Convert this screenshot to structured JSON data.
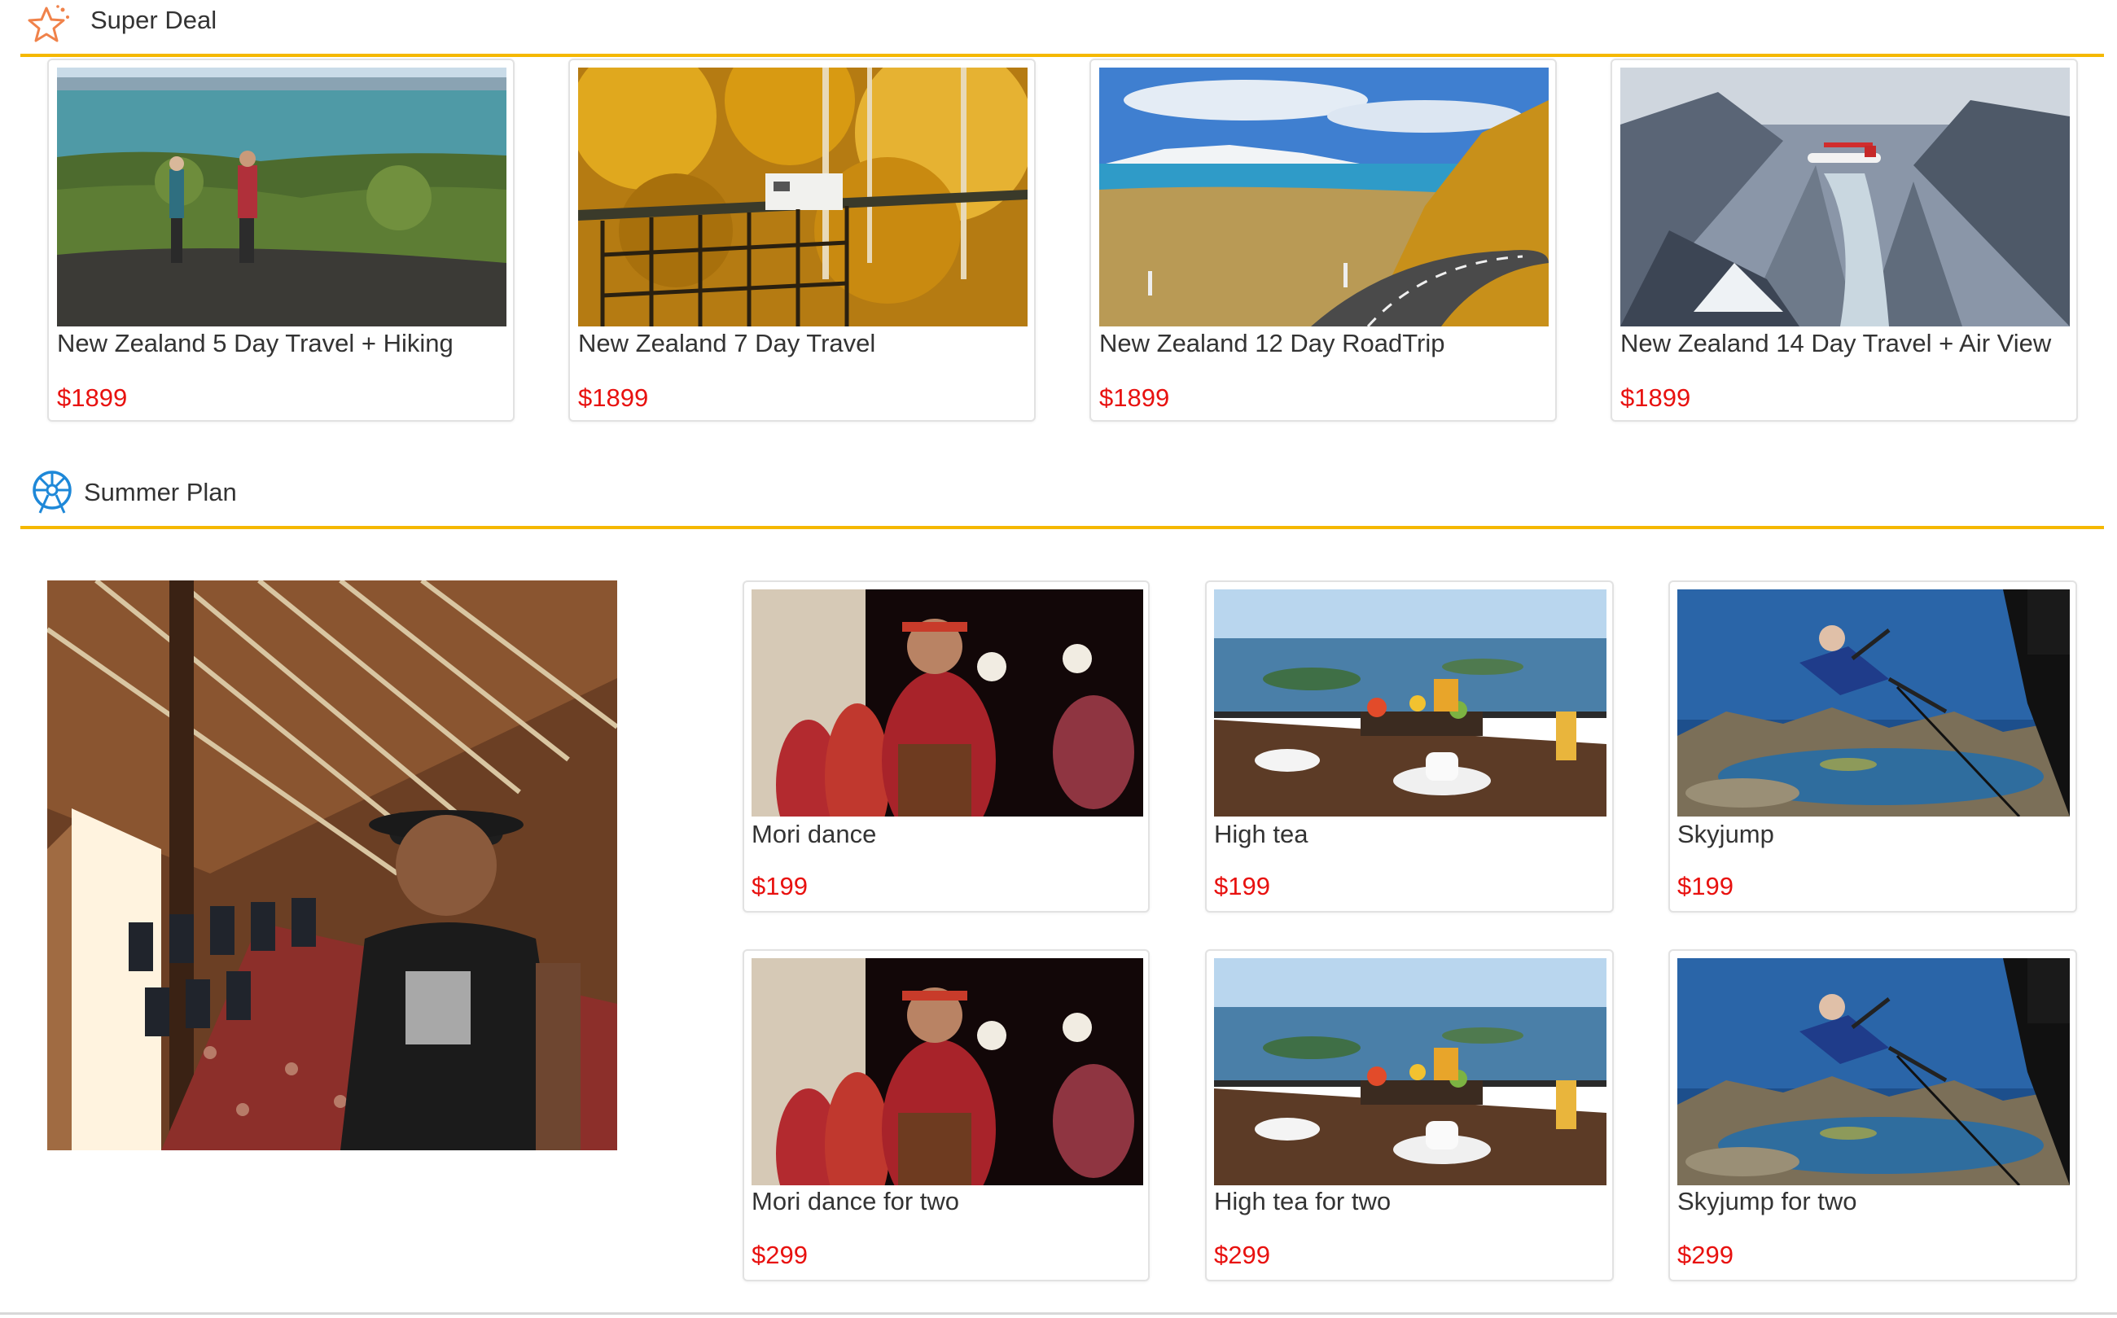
{
  "super_deal": {
    "title": "Super Deal",
    "icon": "star-icon",
    "accent": "#f5b800",
    "items": [
      {
        "name": "New Zealand 5 Day Travel + Hiking",
        "price": "$1899",
        "image": "hikers-coast-photo"
      },
      {
        "name": "New Zealand 7 Day Travel",
        "price": "$1899",
        "image": "autumn-campervan-photo"
      },
      {
        "name": "New Zealand 12 Day RoadTrip",
        "price": "$1899",
        "image": "mountain-road-photo"
      },
      {
        "name": "New Zealand 14 Day Travel + Air View",
        "price": "$1899",
        "image": "fjord-plane-photo"
      }
    ]
  },
  "summer_plan": {
    "title": "Summer Plan",
    "icon": "ferris-wheel-icon",
    "feature_image": "meeting-house-man-photo",
    "items": [
      {
        "name": "Mori dance",
        "price": "$199",
        "image": "maori-dance-photo"
      },
      {
        "name": "High tea",
        "price": "$199",
        "image": "high-tea-photo"
      },
      {
        "name": "Skyjump",
        "price": "$199",
        "image": "skyjump-photo"
      },
      {
        "name": "Mori dance for two",
        "price": "$299",
        "image": "maori-dance-photo"
      },
      {
        "name": "High tea for two",
        "price": "$299",
        "image": "high-tea-photo"
      },
      {
        "name": "Skyjump for two",
        "price": "$299",
        "image": "skyjump-photo"
      }
    ]
  },
  "colors": {
    "price": "#e8110f",
    "divider": "#f5b800",
    "star_icon": "#f0824a",
    "wheel_icon": "#1e88d8"
  }
}
